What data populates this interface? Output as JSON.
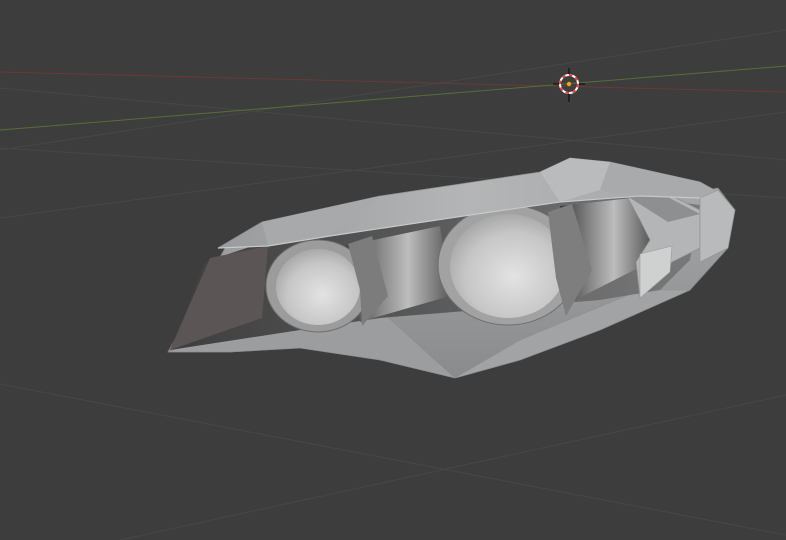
{
  "viewport": {
    "background_color": "#3d3d3d",
    "grid_color": "#4a4a4a",
    "x_axis_color": "#7a3a3a",
    "y_axis_color": "#5a7a3a",
    "cursor_colors": {
      "ring_red": "#e04040",
      "ring_white": "#ffffff",
      "center": "#f0a020"
    },
    "object": {
      "name_semantic": "headlight-mesh",
      "shell_color": "#a9aaab",
      "shell_dark": "#6e6f70",
      "lens_color": "#c9caca",
      "interior_dark": "#505151"
    }
  }
}
